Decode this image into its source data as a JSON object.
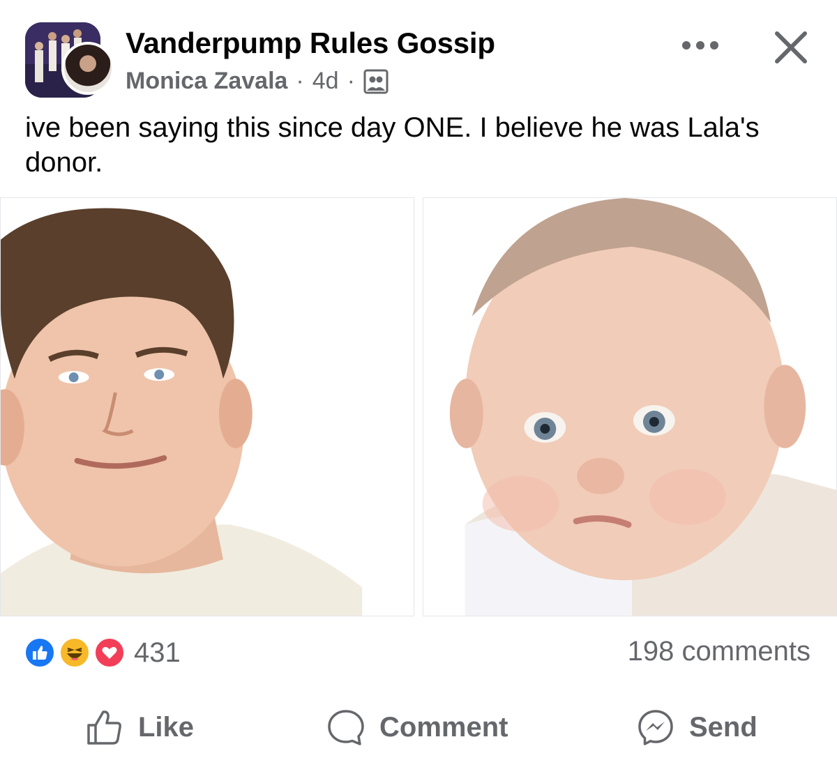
{
  "post": {
    "group_name": "Vanderpump Rules Gossip",
    "author": "Monica Zavala",
    "time": "4d",
    "separator": "·",
    "privacy_icon": "group-members-icon",
    "text": "ive been saying this since day ONE. I believe he was Lala's donor."
  },
  "images": {
    "left_alt": "man-photo",
    "right_alt": "baby-photo"
  },
  "engagement": {
    "reaction_icons": [
      "like-reaction-icon",
      "haha-reaction-icon",
      "love-reaction-icon"
    ],
    "reaction_count": "431",
    "comments": "198 comments"
  },
  "actions": {
    "like": "Like",
    "comment": "Comment",
    "send": "Send"
  },
  "colors": {
    "text_primary": "#050505",
    "text_secondary": "#65676b",
    "like_blue": "#1877f2",
    "haha_yellow": "#f7b928",
    "love_red": "#f33e58"
  }
}
